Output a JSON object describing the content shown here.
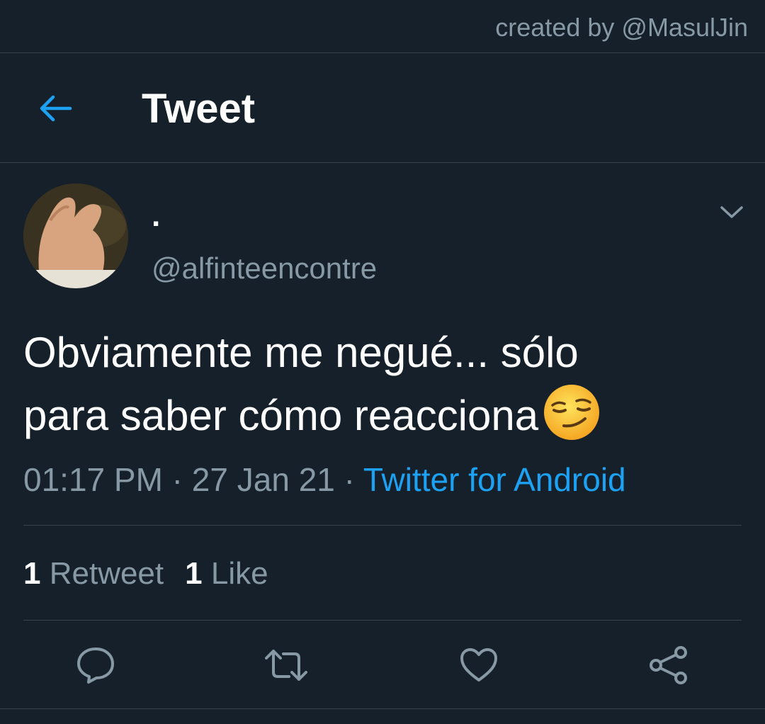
{
  "credit": "created by @MasulJin",
  "header": {
    "title": "Tweet",
    "back_icon": "back-arrow-icon"
  },
  "author": {
    "display_name": ".",
    "handle": "@alfinteencontre"
  },
  "tweet": {
    "line1": "Obviamente me negué... sólo",
    "line2": "para saber cómo reacciona",
    "emoji": "smirking-face-emoji"
  },
  "meta": {
    "time": "01:17 PM",
    "sep1": " · ",
    "date": "27 Jan 21",
    "sep2": " · ",
    "source": "Twitter for Android"
  },
  "stats": {
    "retweets_count": "1",
    "retweets_label": "Retweet",
    "likes_count": "1",
    "likes_label": "Like"
  },
  "actions": [
    "reply-icon",
    "retweet-icon",
    "like-icon",
    "share-icon"
  ],
  "colors": {
    "background": "#15202b",
    "accent": "#1da1f2",
    "muted": "#8899a6",
    "divider": "#38444d"
  }
}
